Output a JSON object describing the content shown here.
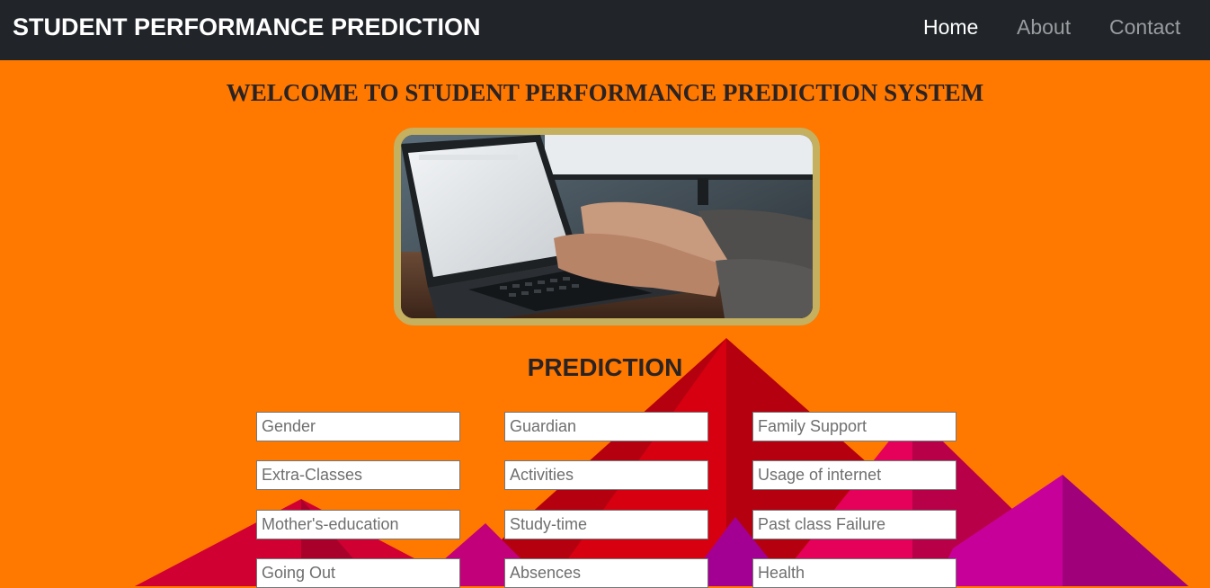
{
  "navbar": {
    "brand": "STUDENT PERFORMANCE PREDICTION",
    "links": [
      {
        "label": "Home",
        "active": true
      },
      {
        "label": "About",
        "active": false
      },
      {
        "label": "Contact",
        "active": false
      }
    ]
  },
  "main": {
    "welcome_heading": "WELCOME TO STUDENT PERFORMANCE PREDICTION SYSTEM",
    "prediction_heading": "PREDICTION",
    "form_fields": [
      {
        "placeholder": "Gender"
      },
      {
        "placeholder": "Guardian"
      },
      {
        "placeholder": "Family Support"
      },
      {
        "placeholder": "Extra-Classes"
      },
      {
        "placeholder": "Activities"
      },
      {
        "placeholder": "Usage of internet"
      },
      {
        "placeholder": "Mother's-education"
      },
      {
        "placeholder": "Study-time"
      },
      {
        "placeholder": "Past class Failure"
      },
      {
        "placeholder": "Going Out"
      },
      {
        "placeholder": "Absences"
      },
      {
        "placeholder": "Health"
      }
    ]
  },
  "colors": {
    "page_background": "#ff7800",
    "navbar_background": "#212529",
    "frame_border": "#c5b060",
    "heading_text": "#2b2323"
  },
  "icons": {
    "hero_image": "laptop-typing-photo"
  }
}
